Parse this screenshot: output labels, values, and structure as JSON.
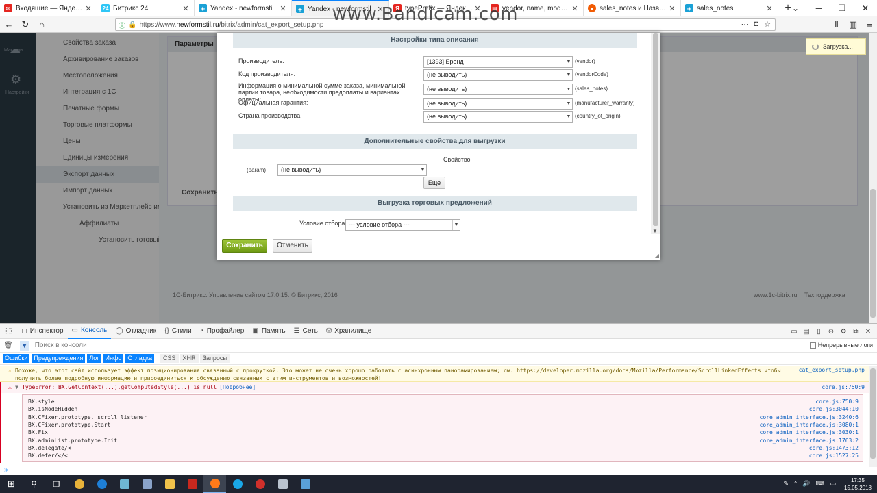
{
  "watermark": "www.Bandicam.com",
  "tabs": [
    {
      "title": "Входящие — Яндекс.Почта",
      "color": "#e52620",
      "glyph": "✉"
    },
    {
      "title": "Битрикс 24",
      "color": "#2fc6f6",
      "glyph": "24"
    },
    {
      "title": "Yandex - newformstil",
      "color": "#1aa1d6",
      "glyph": "◈"
    },
    {
      "title": "Yandex - newformstil",
      "color": "#1aa1d6",
      "glyph": "◈"
    },
    {
      "title": "typePrefix — Яндекс нашлось",
      "color": "#e52620",
      "glyph": "Я"
    },
    {
      "title": "vendor, name, model, typePr",
      "color": "#e52620",
      "glyph": "▤"
    },
    {
      "title": "sales_notes и Название мод",
      "color": "#f25c05",
      "glyph": "●"
    },
    {
      "title": "sales_notes",
      "color": "#1aa1d6",
      "glyph": "◈"
    }
  ],
  "url": {
    "prefix": "https://www.",
    "domain": "newformstil.ru",
    "path": "/bitrix/admin/cat_export_setup.php"
  },
  "left_menu": [
    "Свойства заказа",
    "Архивирование заказов",
    "Местоположения",
    "Интеграция с 1С",
    "Печатные формы",
    "Торговые платформы",
    "Цены",
    "Единицы измерения",
    "Экспорт данных",
    "Импорт данных",
    "Установить из Маркетплейс импорт",
    "Аффилиаты",
    "Установить готовый магазин из Маркетплейс"
  ],
  "background": {
    "content_header": "Параметры",
    "save_label": "Сохранить",
    "footer_left": "1С-Битрикс: Управление сайтом 17.0.15. © Битрикс, 2016",
    "footer_right": "www.1c-bitrix.ru",
    "footer_support": "Техподдержка",
    "loading": "Загрузка...",
    "sidebar_top": "Магазин",
    "sidebar_settings": "Настройки"
  },
  "modal": {
    "section_type": "Настройки типа описания",
    "fields": [
      {
        "label": "Производитель:",
        "value": "[1393] Бренд",
        "code": "(vendor)"
      },
      {
        "label": "Код производителя:",
        "value": "(не выводить)",
        "code": "(vendorCode)"
      },
      {
        "label": "Информация о минимальной сумме заказа, минимальной партии товара, необходимости предоплаты и вариантах оплаты:",
        "value": "(не выводить)",
        "code": "(sales_notes)"
      },
      {
        "label": "Официальная гарантия:",
        "value": "(не выводить)",
        "code": "(manufacturer_warranty)"
      },
      {
        "label": "Страна производства:",
        "value": "(не выводить)",
        "code": "(country_of_origin)"
      }
    ],
    "section_extra": "Дополнительные свойства для выгрузки",
    "property_header": "Свойство",
    "param_label": "(param)",
    "param_value": "(не выводить)",
    "more_button": "Еще",
    "section_offers": "Выгрузка торговых предложений",
    "condition_label": "Условие отбора",
    "condition_value": "--- условие отбора ---",
    "save": "Сохранить",
    "cancel": "Отменить"
  },
  "devtools": {
    "tabs": [
      {
        "label": "Инспектор",
        "icon": "◻"
      },
      {
        "label": "Консоль",
        "icon": "▭"
      },
      {
        "label": "Отладчик",
        "icon": "◯"
      },
      {
        "label": "Стили",
        "icon": "{}"
      },
      {
        "label": "Профайлер",
        "icon": "◔"
      },
      {
        "label": "Память",
        "icon": "▣"
      },
      {
        "label": "Сеть",
        "icon": "☰"
      },
      {
        "label": "Хранилище",
        "icon": "⛁"
      }
    ],
    "search_placeholder": "Поиск в консоли",
    "persist_logs": "Непрерывные логи",
    "levels": [
      "Ошибки",
      "Предупреждения",
      "Лог",
      "Инфо",
      "Отладка"
    ],
    "filters": [
      "CSS",
      "XHR",
      "Запросы"
    ],
    "warning": {
      "text": "Похоже, что этот сайт использует эффект позиционирования связанный с прокруткой. Это может не очень хорошо работать с асинхронным панорамированием; см. https://developer.mozilla.org/docs/Mozilla/Performance/ScrollLinkedEffects чтобы получить более подробную информацию и присоединиться к обсуждению связанных с этим инструментов и возможностей!",
      "source": "cat_export_setup.php"
    },
    "error": {
      "text": "TypeError: BX.GetContext(...).getComputedStyle(...) is null",
      "link": "[Подробнее]",
      "source": "core.js:750:9"
    },
    "stack": [
      {
        "fn": "BX.style",
        "src": "core.js:750:9"
      },
      {
        "fn": "BX.isNodeHidden",
        "src": "core.js:3044:10"
      },
      {
        "fn": "BX.CFixer.prototype._scroll_listener",
        "src": "core_admin_interface.js:3240:6"
      },
      {
        "fn": "BX.CFixer.prototype.Start",
        "src": "core_admin_interface.js:3080:1"
      },
      {
        "fn": "BX.Fix",
        "src": "core_admin_interface.js:3030:1"
      },
      {
        "fn": "BX.adminList.prototype.Init",
        "src": "core_admin_interface.js:1763:2"
      },
      {
        "fn": "BX.delegate/<",
        "src": "core.js:1473:12"
      },
      {
        "fn": "BX.defer/</<",
        "src": "core.js:1527:25"
      }
    ]
  },
  "taskbar": {
    "time": "17:35",
    "date": "15.05.2018",
    "apps": [
      {
        "name": "chrome",
        "color": "#e8b33a"
      },
      {
        "name": "edge",
        "color": "#1e7fd6"
      },
      {
        "name": "notepad",
        "color": "#6fb7d3"
      },
      {
        "name": "network",
        "color": "#8aa3c9"
      },
      {
        "name": "explorer",
        "color": "#f0c24b"
      },
      {
        "name": "filezilla",
        "color": "#c8281e"
      },
      {
        "name": "firefox",
        "color": "#ff7a1a"
      },
      {
        "name": "skype",
        "color": "#1aa8e8"
      },
      {
        "name": "bandicam",
        "color": "#d0302b"
      },
      {
        "name": "files",
        "color": "#b9c3cf"
      },
      {
        "name": "notes",
        "color": "#5aa0d8"
      }
    ]
  }
}
